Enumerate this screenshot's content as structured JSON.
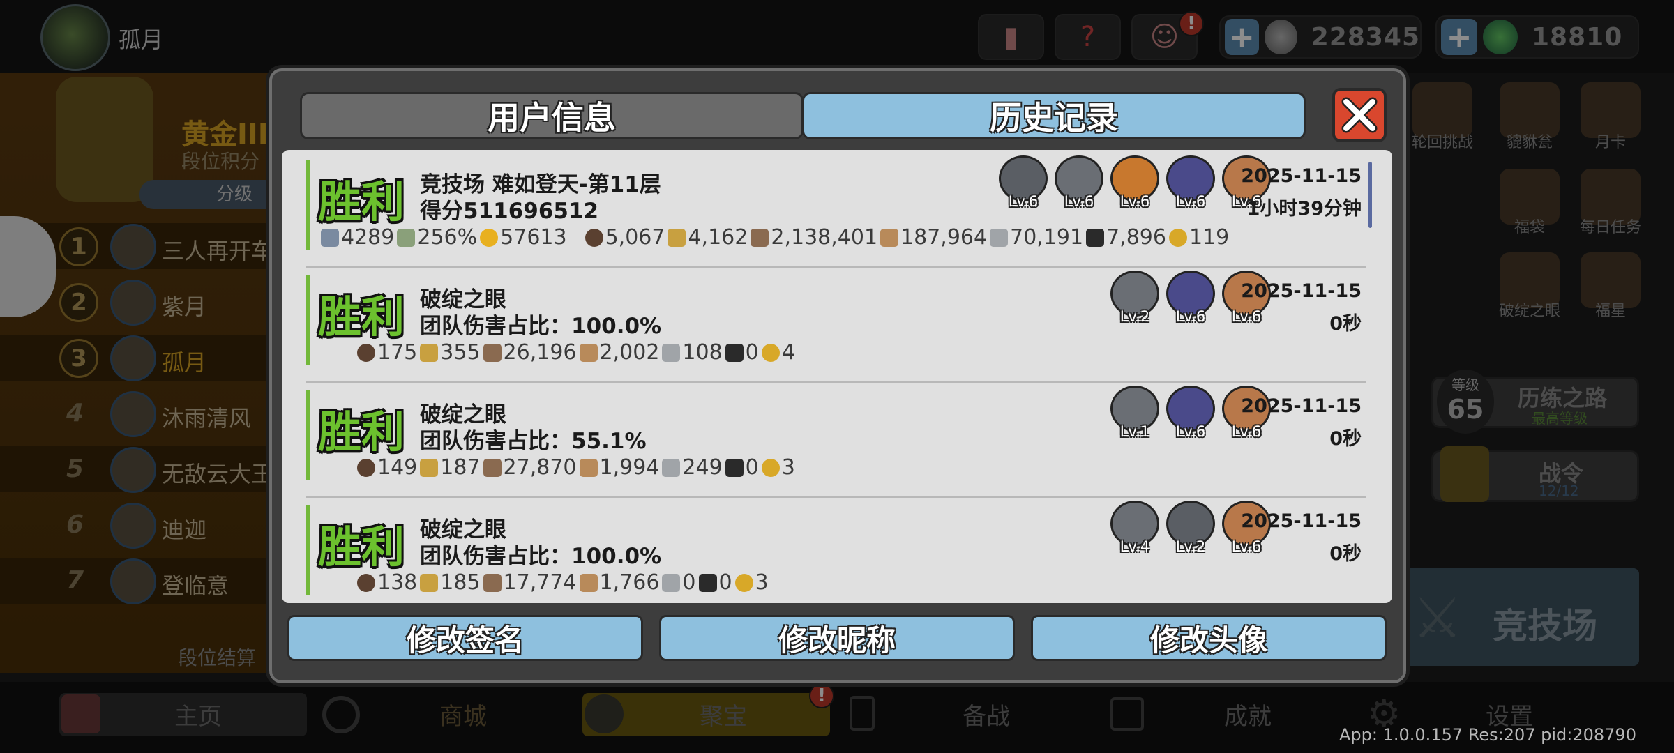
{
  "top": {
    "player_name": "孤月",
    "currency1": "228345",
    "currency2": "18810",
    "notice_badge": "!"
  },
  "left": {
    "rank_title": "黄金III",
    "rank_sub": "段位积分",
    "points_label": "分级",
    "ranking": [
      {
        "rank": "1",
        "name": "三人再开车"
      },
      {
        "rank": "2",
        "name": "紫月"
      },
      {
        "rank": "3",
        "name": "孤月"
      },
      {
        "rank": "4",
        "name": "沐雨清风"
      },
      {
        "rank": "5",
        "name": "无敌云大王"
      },
      {
        "rank": "6",
        "name": "迪迦"
      },
      {
        "rank": "7",
        "name": "登临意"
      }
    ],
    "footer": "段位结算"
  },
  "right": {
    "icons": [
      {
        "label": "轮回挑战"
      },
      {
        "label": "貔貅瓮"
      },
      {
        "label": "月卡"
      },
      {
        "label": "福袋"
      },
      {
        "label": "每日任务"
      },
      {
        "label": "破绽之眼"
      },
      {
        "label": "福星"
      }
    ],
    "level_label": "等级",
    "level": "65",
    "trial_road": "历练之路",
    "trial_sub": "最高等级",
    "battle_pass": "战令",
    "battle_pass_progress": "12/12",
    "arena": "竞技场"
  },
  "nav": {
    "items": [
      "主页",
      "商城",
      "聚宝",
      "备战",
      "成就",
      "设置"
    ],
    "version": "App: 1.0.0.157 Res:207 pid:208790"
  },
  "modal": {
    "tab_user": "用户信息",
    "tab_history": "历史记录",
    "records": [
      {
        "result": "胜利",
        "line1": "竞技场 难如登天-第11层",
        "line2": "得分511696512",
        "date": "2025-11-15",
        "duration": "1小时39分钟",
        "heroes": [
          "Lv.6",
          "Lv.6",
          "Lv.6",
          "Lv.6",
          "Lv.6"
        ],
        "extra_stats": [
          "4289",
          "256%",
          "57613"
        ],
        "stats": [
          "5,067",
          "4,162",
          "2,138,401",
          "187,964",
          "70,191",
          "7,896",
          "119"
        ]
      },
      {
        "result": "胜利",
        "line1": "破绽之眼",
        "line2": "团队伤害占比：100.0%",
        "date": "2025-11-15",
        "duration": "0秒",
        "heroes": [
          "Lv.2",
          "Lv.6",
          "Lv.6"
        ],
        "extra_stats": [],
        "stats": [
          "175",
          "355",
          "26,196",
          "2,002",
          "108",
          "0",
          "4"
        ]
      },
      {
        "result": "胜利",
        "line1": "破绽之眼",
        "line2": "团队伤害占比：55.1%",
        "date": "2025-11-15",
        "duration": "0秒",
        "heroes": [
          "Lv.1",
          "Lv.6",
          "Lv.6"
        ],
        "extra_stats": [],
        "stats": [
          "149",
          "187",
          "27,870",
          "1,994",
          "249",
          "0",
          "3"
        ]
      },
      {
        "result": "胜利",
        "line1": "破绽之眼",
        "line2": "团队伤害占比：100.0%",
        "date": "2025-11-15",
        "duration": "0秒",
        "heroes": [
          "Lv.4",
          "Lv.2",
          "Lv.6"
        ],
        "extra_stats": [],
        "stats": [
          "138",
          "185",
          "17,774",
          "1,766",
          "0",
          "0",
          "3"
        ]
      }
    ],
    "buttons": [
      "修改签名",
      "修改昵称",
      "修改头像"
    ]
  },
  "colors": {
    "victory_green": "#6cc12e",
    "tab_blue": "#8ec0de",
    "close_red": "#d9472e"
  }
}
